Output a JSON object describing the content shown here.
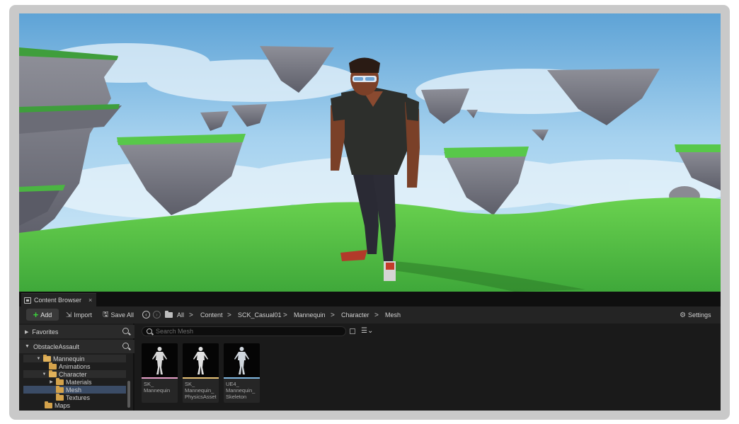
{
  "content_browser": {
    "tab_title": "Content Browser",
    "tab_close": "×",
    "toolbar": {
      "add_label": "Add",
      "import_label": "Import",
      "save_all_label": "Save All",
      "settings_label": "Settings"
    },
    "breadcrumb": [
      "All",
      "Content",
      "SCK_Casual01",
      "Mannequin",
      "Character",
      "Mesh"
    ],
    "breadcrumb_separator": ">",
    "left_panel": {
      "favorites_label": "Favorites",
      "project_label": "ObstacleAssault",
      "tree": [
        {
          "label": "Mannequin",
          "state": "open"
        },
        {
          "label": "Animations",
          "state": "leaf"
        },
        {
          "label": "Character",
          "state": "open"
        },
        {
          "label": "Materials",
          "state": "collapsed"
        },
        {
          "label": "Mesh",
          "state": "selected"
        },
        {
          "label": "Textures",
          "state": "leaf"
        },
        {
          "label": "Maps",
          "state": "leaf"
        }
      ]
    },
    "search": {
      "placeholder": "Search Mesh",
      "value": ""
    },
    "assets": [
      {
        "label": "SK_\nMannequin",
        "type_color": "#e8a1c9"
      },
      {
        "label": "SK_\nMannequin_\nPhysicsAsset",
        "type_color": "#e8c276"
      },
      {
        "label": "UE4_\nMannequin_\nSkeleton",
        "type_color": "#7fb6e0"
      }
    ]
  },
  "icons": {
    "tab": "content-browser-icon",
    "add": "plus-icon",
    "import": "import-icon",
    "save_all": "save-icon",
    "history_back": "back-circle-icon",
    "history_forward": "forward-circle-icon",
    "folder": "folder-icon",
    "settings": "gear-icon",
    "search": "search-icon",
    "filter": "filter-icon"
  },
  "colors": {
    "sky": "#a9d4ee",
    "grass": "#4fc145",
    "panel": "#1a1a1a",
    "selection": "#3b4c66",
    "folder": "#d4a24b"
  }
}
